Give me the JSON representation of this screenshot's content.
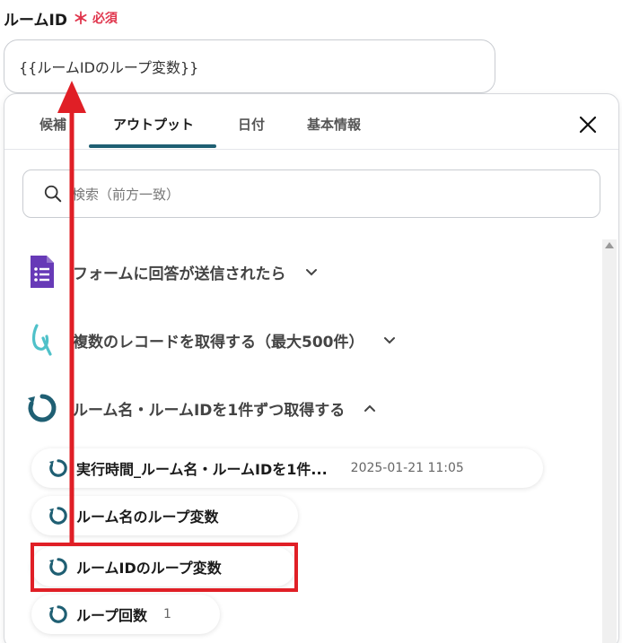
{
  "field": {
    "label": "ルームID",
    "required_mark": "＊",
    "required_text": "必須",
    "value": "{{ルームIDのループ変数}}"
  },
  "tabs": [
    {
      "label": "候補",
      "active": false
    },
    {
      "label": "アウトプット",
      "active": true
    },
    {
      "label": "日付",
      "active": false
    },
    {
      "label": "基本情報",
      "active": false
    }
  ],
  "search": {
    "placeholder": "検索（前方一致）"
  },
  "groups": [
    {
      "title": "フォームに回答が送信されたら",
      "icon": "google-forms-icon",
      "expanded": false
    },
    {
      "title": "複数のレコードを取得する（最大500件）",
      "icon": "kintone-icon",
      "expanded": false
    },
    {
      "title": "ルーム名・ルームIDを1件ずつ取得する",
      "icon": "loop-icon",
      "expanded": true
    }
  ],
  "outputs": [
    {
      "label": "実行時間_ルーム名・ルームIDを1件...",
      "meta": "2025-01-21 11:05"
    },
    {
      "label": "ルーム名のループ変数",
      "meta": ""
    },
    {
      "label": "ルームIDのループ変数",
      "meta": ""
    },
    {
      "label": "ループ回数",
      "meta": "1"
    }
  ],
  "colors": {
    "accent": "#1f5f73",
    "required": "#e0364d",
    "annotation": "#e01f26",
    "forms_purple": "#673ab7",
    "kintone_teal": "#4fc1c9"
  }
}
